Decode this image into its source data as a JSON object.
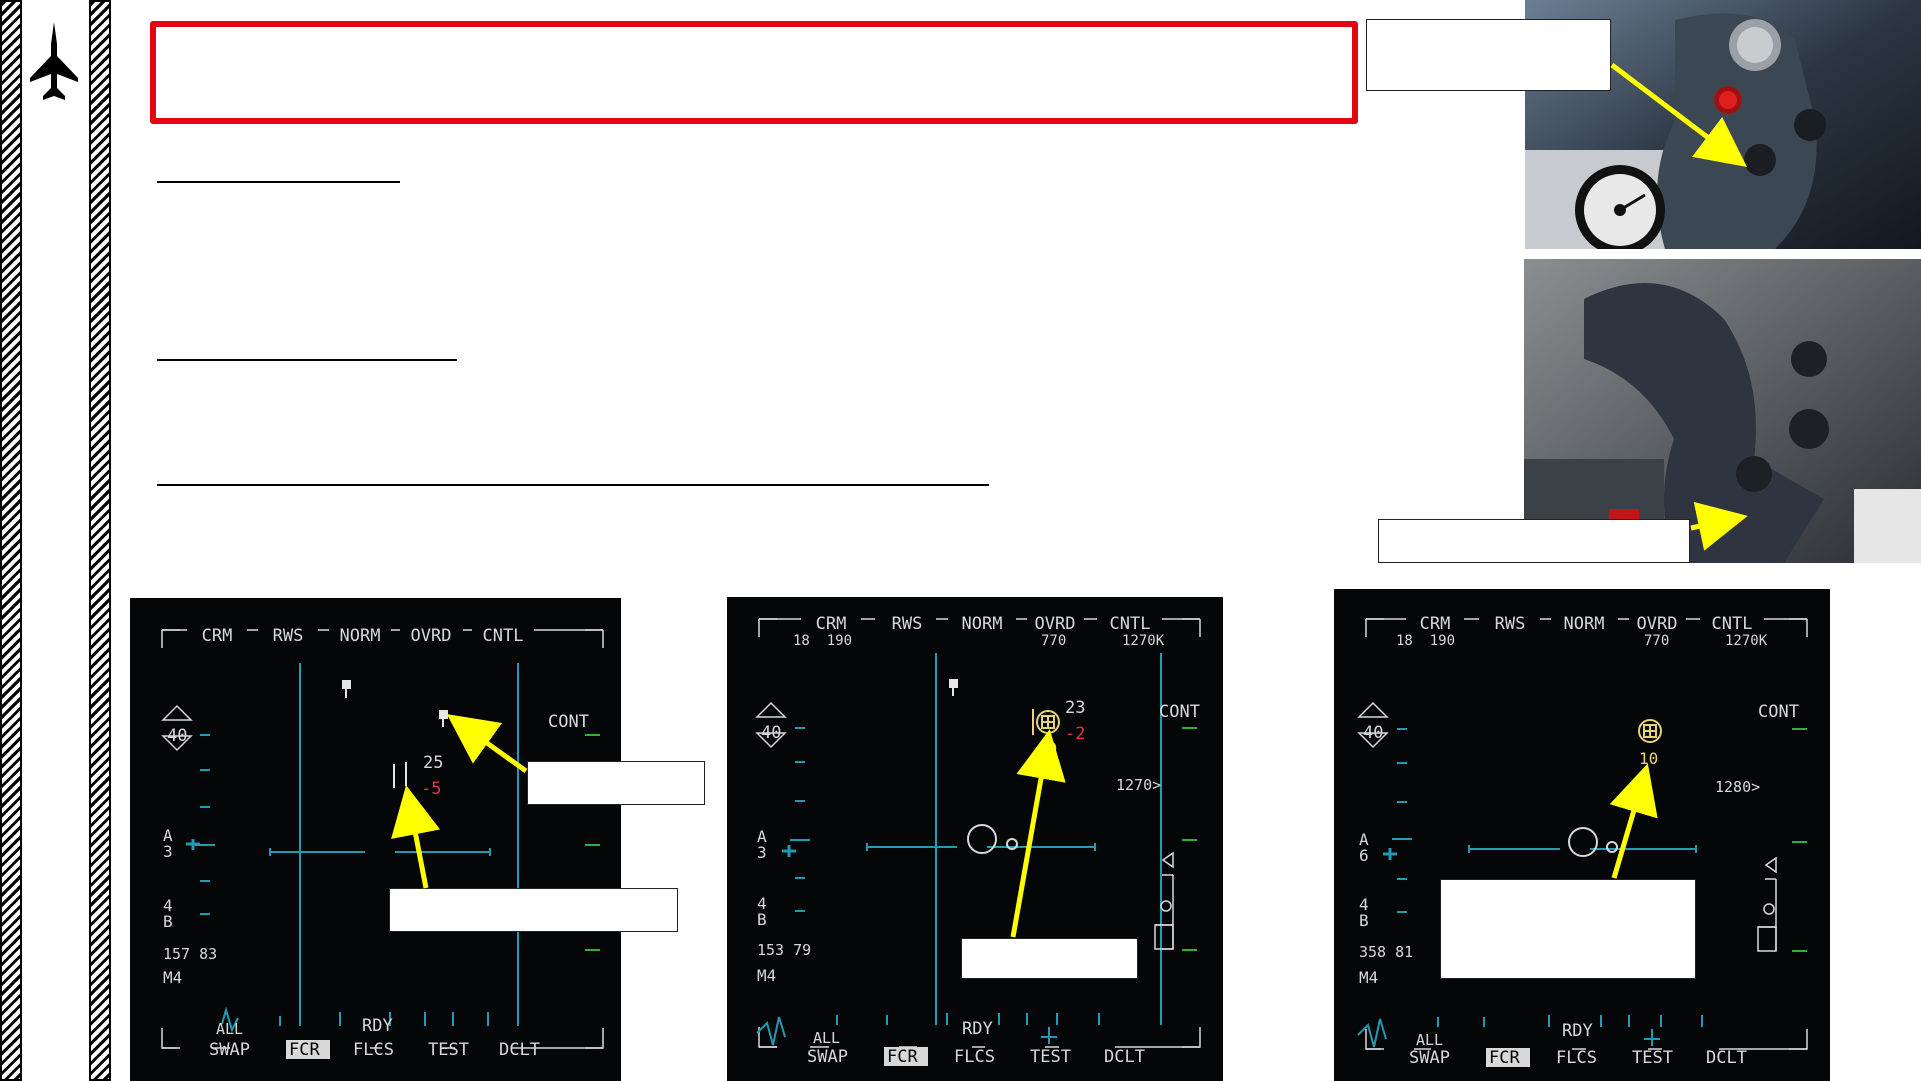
{
  "slide": {
    "title": "",
    "section_headings": [
      "",
      "",
      ""
    ],
    "callouts": {
      "photo_top": "",
      "photo_bottom": "",
      "mfd1_target": "",
      "mfd1_cursor": "",
      "mfd2_lock": "",
      "mfd3_lock": ""
    }
  },
  "colors": {
    "title_border": "#e30613",
    "arrow": "#ffff00",
    "mfd_text": "#d8d8d8",
    "mfd_cyan": "#1f9bb5",
    "mfd_green": "#2fae3a",
    "mfd_red": "#e0344a",
    "mfd_yellow": "#e8d27a"
  },
  "mfd1": {
    "osb_top": [
      "CRM",
      "RWS",
      "NORM",
      "OVRD",
      "CNTL"
    ],
    "osb_bottom": [
      "SWAP",
      "FCR",
      "FLCS",
      "TEST",
      "DCLT"
    ],
    "all_label": "ALL",
    "rdy_label": "RDY",
    "cont_label": "CONT",
    "range_value": "40",
    "az_label": "A",
    "az_value": "3",
    "bar_label": "4",
    "bar_suffix": "B",
    "cursor_alt_top": "25",
    "cursor_alt_bottom": "-5",
    "bottom_info": "157 83",
    "mode_label": "M4"
  },
  "mfd2": {
    "osb_top": [
      "CRM",
      "RWS",
      "NORM",
      "OVRD",
      "CNTL"
    ],
    "osb_bottom": [
      "SWAP",
      "FCR",
      "FLCS",
      "TEST",
      "DCLT"
    ],
    "top_left_info": "18  190",
    "top_mid_info": "770",
    "top_right_info": "1270K",
    "all_label": "ALL",
    "rdy_label": "RDY",
    "cont_label": "CONT",
    "range_value": "40",
    "az_label": "A",
    "az_value": "3",
    "bar_label": "4",
    "bar_suffix": "B",
    "target_alt": "23",
    "target_delta": "-2",
    "target_mach": "10",
    "closure": "1270>",
    "bottom_info": "153 79",
    "mode_label": "M4"
  },
  "mfd3": {
    "osb_top": [
      "CRM",
      "RWS",
      "NORM",
      "OVRD",
      "CNTL"
    ],
    "osb_bottom": [
      "SWAP",
      "FCR",
      "FLCS",
      "TEST",
      "DCLT"
    ],
    "top_left_info": "18  190",
    "top_mid_info": "770",
    "top_right_info": "1270K",
    "all_label": "ALL",
    "rdy_label": "RDY",
    "cont_label": "CONT",
    "range_value": "40",
    "az_label": "A",
    "az_value": "6",
    "bar_label": "4",
    "bar_suffix": "B",
    "target_mach": "10",
    "closure": "1280>",
    "bottom_info": "358 81",
    "mode_label": "M4"
  }
}
